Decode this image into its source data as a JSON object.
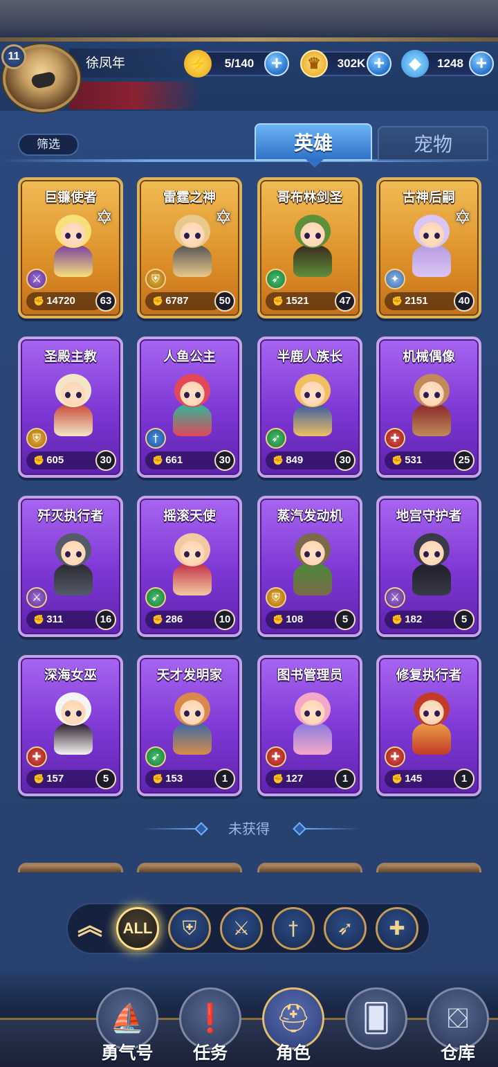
{
  "player": {
    "level": "11",
    "name": "徐凤年"
  },
  "resources": {
    "energy": "5/140",
    "coins": "302K",
    "gems": "1248"
  },
  "toolbar": {
    "filter_label": "筛选"
  },
  "tabs": [
    {
      "label": "英雄",
      "active": true
    },
    {
      "label": "宠物",
      "active": false
    }
  ],
  "heroes": [
    {
      "name": "巨镰使者",
      "power": "14720",
      "level": "63",
      "rarity": "gold",
      "class_icon": "axe-icon",
      "starred": true
    },
    {
      "name": "雷霆之神",
      "power": "6787",
      "level": "50",
      "rarity": "gold",
      "class_icon": "shield-icon",
      "starred": true
    },
    {
      "name": "哥布林剑圣",
      "power": "1521",
      "level": "47",
      "rarity": "gold",
      "class_icon": "bow-icon",
      "starred": false
    },
    {
      "name": "古神后嗣",
      "power": "2151",
      "level": "40",
      "rarity": "gold",
      "class_icon": "mage-icon",
      "starred": true
    },
    {
      "name": "圣殿主教",
      "power": "605",
      "level": "30",
      "rarity": "purple",
      "class_icon": "shield-icon",
      "starred": false
    },
    {
      "name": "人鱼公主",
      "power": "661",
      "level": "30",
      "rarity": "purple",
      "class_icon": "sword-icon",
      "starred": false
    },
    {
      "name": "半鹿人族长",
      "power": "849",
      "level": "30",
      "rarity": "purple",
      "class_icon": "bow-icon",
      "starred": false
    },
    {
      "name": "机械偶像",
      "power": "531",
      "level": "25",
      "rarity": "purple",
      "class_icon": "cross-icon",
      "starred": false
    },
    {
      "name": "歼灭执行者",
      "power": "311",
      "level": "16",
      "rarity": "purple",
      "class_icon": "axe-icon",
      "starred": false
    },
    {
      "name": "摇滚天使",
      "power": "286",
      "level": "10",
      "rarity": "purple",
      "class_icon": "bow-icon",
      "starred": false
    },
    {
      "name": "蒸汽发动机",
      "power": "108",
      "level": "5",
      "rarity": "purple",
      "class_icon": "shield-icon",
      "starred": false
    },
    {
      "name": "地宫守护者",
      "power": "182",
      "level": "5",
      "rarity": "purple",
      "class_icon": "axe-icon",
      "starred": false
    },
    {
      "name": "深海女巫",
      "power": "157",
      "level": "5",
      "rarity": "purple",
      "class_icon": "cross-icon",
      "starred": false
    },
    {
      "name": "天才发明家",
      "power": "153",
      "level": "1",
      "rarity": "purple",
      "class_icon": "bow-icon",
      "starred": false
    },
    {
      "name": "图书管理员",
      "power": "127",
      "level": "1",
      "rarity": "purple",
      "class_icon": "cross-icon",
      "starred": false
    },
    {
      "name": "修复执行者",
      "power": "145",
      "level": "1",
      "rarity": "purple",
      "class_icon": "cross-icon",
      "starred": false
    }
  ],
  "section": {
    "unobtained_label": "未获得"
  },
  "class_filter": {
    "all_label": "ALL",
    "classes": [
      "shield-icon",
      "axe-icon",
      "sword-icon",
      "bow-icon",
      "cross-icon"
    ]
  },
  "nav": [
    {
      "label": "勇气号",
      "icon": "ship-icon",
      "active": false
    },
    {
      "label": "任务",
      "icon": "quest-icon",
      "active": false
    },
    {
      "label": "角色",
      "icon": "helmet-icon",
      "active": true
    },
    {
      "label": "",
      "icon": "card-icon",
      "active": false
    },
    {
      "label": "仓库",
      "icon": "chest-icon",
      "active": false
    }
  ],
  "colors": {
    "gold_card": "#dc8f28",
    "purple_card": "#7d36d4",
    "tab_active": "#2f72c8",
    "background": "#2a4677"
  }
}
